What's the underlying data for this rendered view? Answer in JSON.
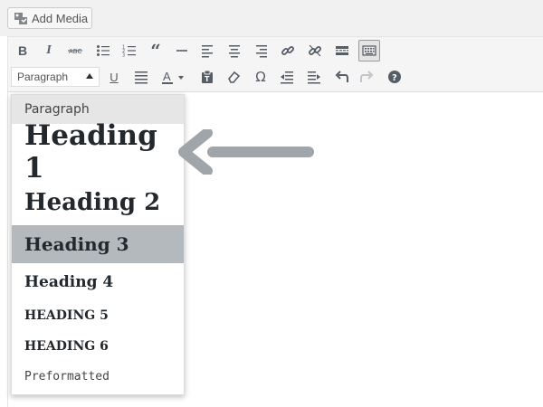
{
  "add_media": {
    "label": "Add Media"
  },
  "toolbar": {
    "row1": [
      {
        "name": "bold-button",
        "icon": "bold"
      },
      {
        "name": "italic-button",
        "icon": "italic"
      },
      {
        "name": "strikethrough-button",
        "icon": "strikethrough"
      },
      {
        "name": "bullet-list-button",
        "icon": "bullet-list"
      },
      {
        "name": "numbered-list-button",
        "icon": "numbered-list"
      },
      {
        "name": "blockquote-button",
        "icon": "blockquote"
      },
      {
        "name": "horizontal-line-button",
        "icon": "horizontal-line"
      },
      {
        "name": "align-left-button",
        "icon": "align-left"
      },
      {
        "name": "align-center-button",
        "icon": "align-center"
      },
      {
        "name": "align-right-button",
        "icon": "align-right"
      },
      {
        "name": "insert-link-button",
        "icon": "link"
      },
      {
        "name": "remove-link-button",
        "icon": "unlink"
      },
      {
        "name": "read-more-button",
        "icon": "read-more"
      },
      {
        "name": "toolbar-toggle-button",
        "icon": "keyboard"
      }
    ],
    "row2": [
      {
        "name": "underline-button",
        "icon": "underline"
      },
      {
        "name": "justify-button",
        "icon": "justify"
      },
      {
        "name": "text-color-button",
        "icon": "text-color"
      },
      {
        "name": "paste-as-text-button",
        "icon": "clipboard"
      },
      {
        "name": "clear-formatting-button",
        "icon": "eraser"
      },
      {
        "name": "special-character-button",
        "icon": "omega"
      },
      {
        "name": "decrease-indent-button",
        "icon": "outdent"
      },
      {
        "name": "increase-indent-button",
        "icon": "indent"
      },
      {
        "name": "undo-button",
        "icon": "undo"
      },
      {
        "name": "redo-button",
        "icon": "redo"
      },
      {
        "name": "help-button",
        "icon": "help"
      }
    ]
  },
  "format_select": {
    "value": "Paragraph"
  },
  "dropdown": {
    "items": [
      {
        "label": "Paragraph"
      },
      {
        "label": "Heading 1"
      },
      {
        "label": "Heading 2"
      },
      {
        "label": "Heading 3"
      },
      {
        "label": "Heading 4"
      },
      {
        "label": "HEADING 5"
      },
      {
        "label": "HEADING 6"
      },
      {
        "label": "Preformatted"
      }
    ],
    "highlighted": "Heading 3"
  },
  "colors": {
    "toolbar_bg": "#f5f5f5",
    "highlight": "#b4b9be",
    "arrow": "#a0a5aa",
    "icon": "#555d66"
  }
}
